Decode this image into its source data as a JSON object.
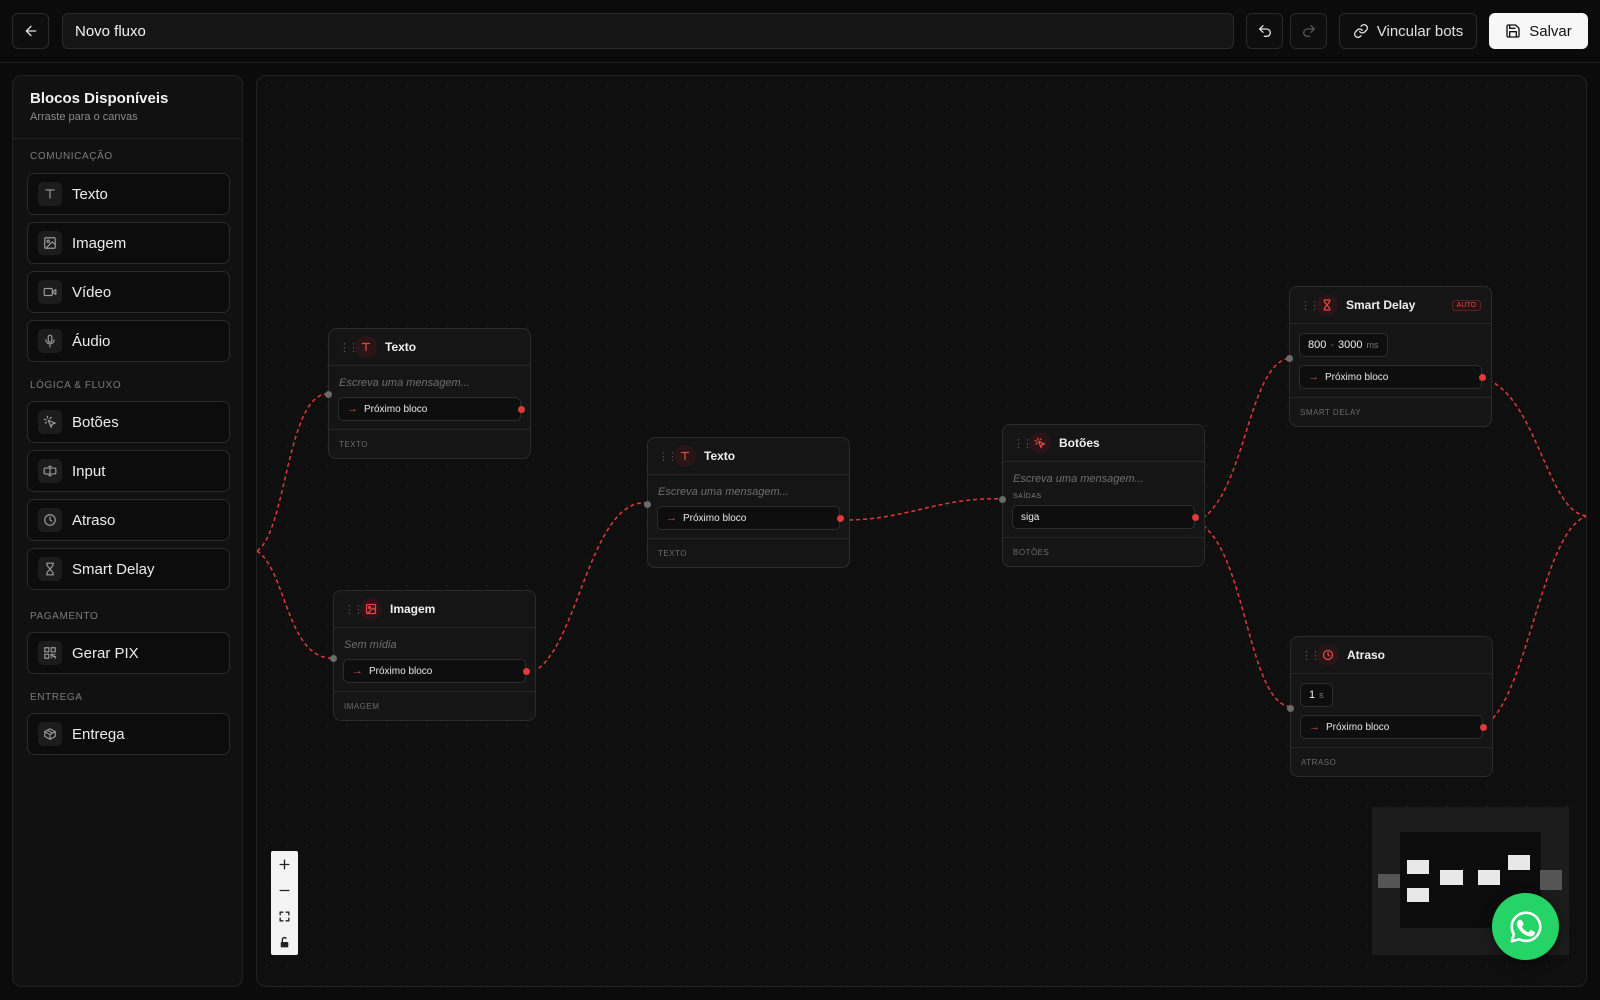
{
  "topbar": {
    "flow_name": "Novo fluxo",
    "link_label": "Vincular bots",
    "save_label": "Salvar"
  },
  "sidebar": {
    "title": "Blocos Disponíveis",
    "subtitle": "Arraste para o canvas",
    "sections": [
      {
        "label": "COMUNICAÇÃO",
        "items": [
          {
            "label": "Texto",
            "icon": "text-icon"
          },
          {
            "label": "Imagem",
            "icon": "image-icon"
          },
          {
            "label": "Vídeo",
            "icon": "video-icon"
          },
          {
            "label": "Áudio",
            "icon": "mic-icon"
          }
        ]
      },
      {
        "label": "LÓGICA & FLUXO",
        "items": [
          {
            "label": "Botões",
            "icon": "pointer-icon"
          },
          {
            "label": "Input",
            "icon": "input-icon"
          },
          {
            "label": "Atraso",
            "icon": "clock-icon"
          },
          {
            "label": "Smart Delay",
            "icon": "hourglass-icon"
          }
        ]
      },
      {
        "label": "PAGAMENTO",
        "items": [
          {
            "label": "Gerar PIX",
            "icon": "qr-icon"
          }
        ]
      },
      {
        "label": "ENTREGA",
        "items": [
          {
            "label": "Entrega",
            "icon": "box-icon"
          }
        ]
      }
    ]
  },
  "canvas": {
    "nodes": {
      "texto1": {
        "title": "Texto",
        "placeholder": "Escreva uma mensagem...",
        "next": "Próximo bloco",
        "footer": "TEXTO"
      },
      "imagem": {
        "title": "Imagem",
        "placeholder": "Sem mídia",
        "next": "Próximo bloco",
        "footer": "IMAGEM"
      },
      "texto2": {
        "title": "Texto",
        "placeholder": "Escreva uma mensagem...",
        "next": "Próximo bloco",
        "footer": "TEXTO"
      },
      "botoes": {
        "title": "Botões",
        "placeholder": "Escreva uma mensagem...",
        "outputs_label": "SAÍDAS",
        "button": "siga",
        "footer": "BOTÕES"
      },
      "smart_delay": {
        "title": "Smart Delay",
        "badge": "AUTO",
        "min": "800",
        "sep": "-",
        "max": "3000",
        "unit": "ms",
        "next": "Próximo bloco",
        "footer": "SMART DELAY"
      },
      "atraso": {
        "title": "Atraso",
        "value": "1",
        "unit": "s",
        "next": "Próximo bloco",
        "footer": "ATRASO"
      }
    },
    "edge_color": "#e03a3a"
  },
  "colors": {
    "accent": "#e04848",
    "whatsapp": "#25d366"
  }
}
